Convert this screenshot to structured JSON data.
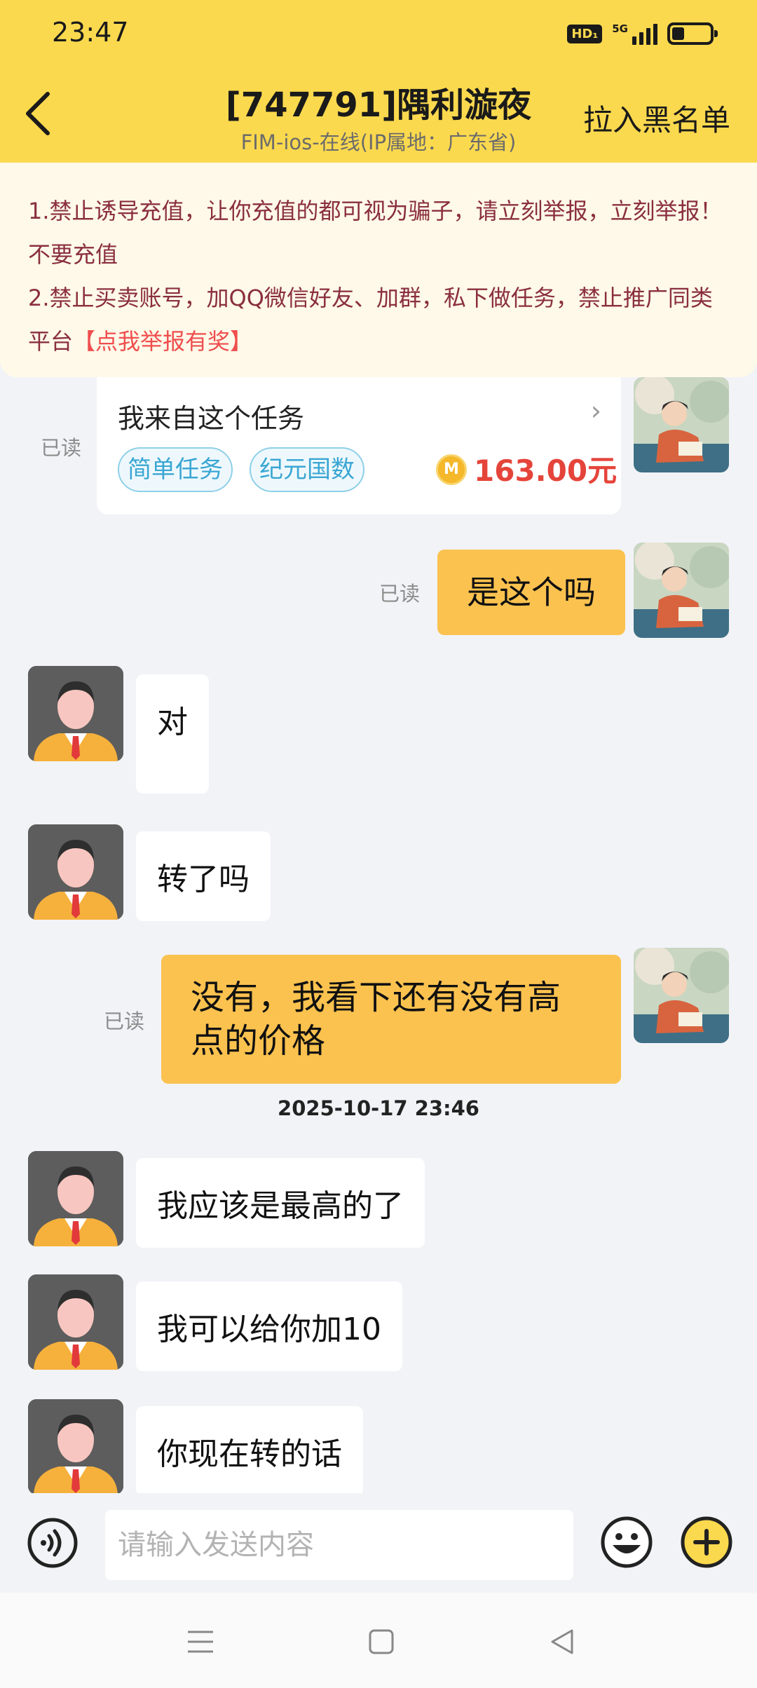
{
  "status_bar": {
    "time": "23:47",
    "hd": "HD₁",
    "network": "5G"
  },
  "header": {
    "title": "[747791]隅利漩夜",
    "subtitle": "FIM-ios-在线(IP属地：广东省)",
    "blacklist_label": "拉入黑名单"
  },
  "notice": {
    "line1": "1.禁止诱导充值，让你充值的都可视为骗子，请立刻举报，立刻举报！不要充值",
    "line2_prefix": "2.禁止买卖账号，加QQ微信好友、加群，私下做任务，禁止推广同类平台",
    "report_link": "【点我举报有奖】"
  },
  "task_card": {
    "title": "我来自这个任务",
    "tags": [
      "简单任务",
      "纪元国数"
    ],
    "coin_symbol": "M",
    "price": "163.00元",
    "read": "已读"
  },
  "messages": [
    {
      "side": "right",
      "text": "是这个吗",
      "read": "已读"
    },
    {
      "side": "left",
      "text": "对"
    },
    {
      "side": "left",
      "text": "转了吗"
    },
    {
      "side": "right",
      "text": "没有，我看下还有没有高点的价格",
      "read": "已读"
    },
    {
      "side": "left",
      "text": "我应该是最高的了"
    },
    {
      "side": "left",
      "text": "我可以给你加10"
    },
    {
      "side": "left",
      "text": "你现在转的话"
    }
  ],
  "timestamp": "2025-10-17 23:46",
  "input": {
    "placeholder": "请输入发送内容"
  }
}
